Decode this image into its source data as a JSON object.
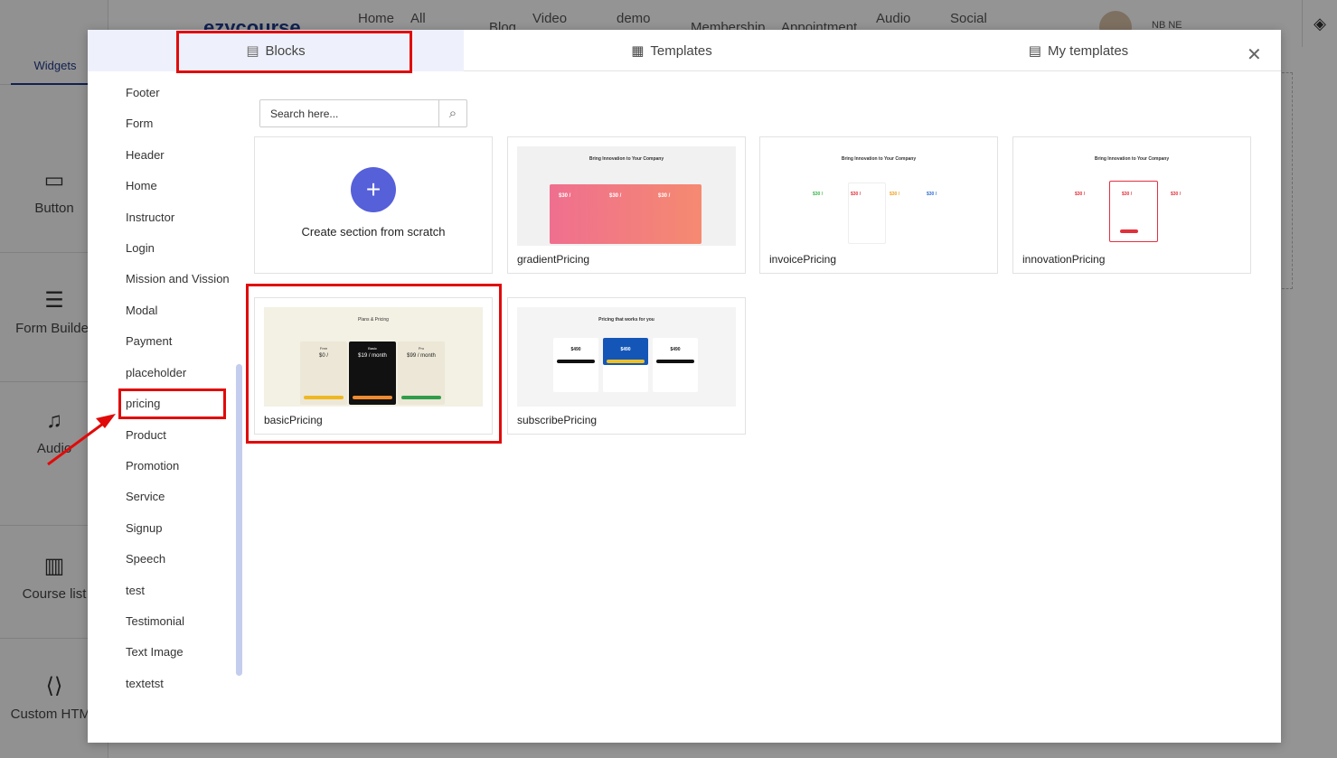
{
  "background": {
    "logo": "ezycourse",
    "nav": [
      "Home",
      "All",
      "Blog",
      "Video",
      "demo",
      "Membership",
      "Appointment",
      "Audio",
      "Social"
    ],
    "user_initials": "NB NE",
    "widgets_tab": "Widgets",
    "widgets": [
      "Button",
      "Form Builder",
      "Audio",
      "Course list",
      "Custom HTML"
    ]
  },
  "modal": {
    "tabs": [
      {
        "label": "Blocks",
        "icon": "blocks-icon",
        "active": true
      },
      {
        "label": "Templates",
        "icon": "templates-icon",
        "active": false
      },
      {
        "label": "My templates",
        "icon": "document-icon",
        "active": false
      }
    ],
    "close": "✕",
    "categories": [
      "Footer",
      "Form",
      "Header",
      "Home",
      "Instructor",
      "Login",
      "Mission and Vission",
      "Modal",
      "Payment",
      "placeholder",
      "pricing",
      "Product",
      "Promotion",
      "Service",
      "Signup",
      "Speech",
      "test",
      "Testimonial",
      "Text Image",
      "textetst"
    ],
    "selected_category": "pricing",
    "search": {
      "placeholder": "Search here..."
    },
    "create_label": "Create section from scratch",
    "blocks": [
      "gradientPricing",
      "invoicePricing",
      "innovationPricing",
      "basicPricing",
      "subscribePricing"
    ]
  },
  "thumbs": {
    "innovation_title": "Bring Innovation to Your Company",
    "price": "$30 /",
    "basic_title": "Plans & Pricing",
    "basic_plans": [
      "Free",
      "Basic",
      "Pro"
    ],
    "basic_prices": [
      "$0 /",
      "$19 / month",
      "$99 / month"
    ],
    "subscribe_title": "Pricing that works for you",
    "subscribe_price": "$490"
  },
  "colors": {
    "accent": "#5660d9",
    "highlight": "#e10a0a",
    "active_tab": "#eef1fb"
  }
}
